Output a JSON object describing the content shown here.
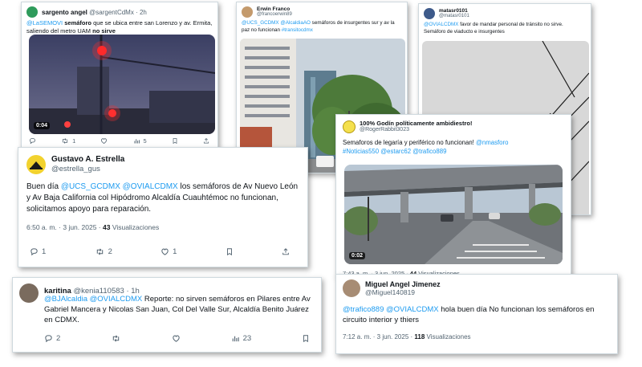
{
  "tweets": {
    "t1": {
      "name": "sargento angel",
      "handle": "@sargentCdMx",
      "sep": "·",
      "time": "2h",
      "mention": "@LaSEMOVI",
      "text_a": " semáforo",
      "text_b": " que se ubica entre san Lorenzo y av. Ermita, saliendo del metro UAM ",
      "text_c": "no sirve",
      "duration": "0:04",
      "retweets": "1",
      "likes": "5",
      "avatar_color": "#2e9b5b"
    },
    "t2": {
      "name": "Erwin Franco",
      "handle": "@francoerwin89",
      "mention_a": "@UCS_GCDMX",
      "mention_b": "@AlcaldiaAO",
      "text": " semáforos de insurgentes sur y av la paz no funcionan ",
      "hashtag": "#transitocdmx"
    },
    "t3": {
      "name": "matasr0101",
      "handle": "@matasr0101",
      "mention": "@OVIALCDMX",
      "text": " favor de mandar personal de tránsito no sirve. Semáforo de viaducto e insurgentes"
    },
    "t4": {
      "name": "Gustavo A. Estrella",
      "handle": "@estrella_gus",
      "text_a": "Buen día ",
      "mention_a": "@UCS_GCDMX",
      "mention_b": "@OVIALCDMX",
      "text_b": " los semáforos de Av Nuevo León y Av Baja California col Hipódromo Alcaldía Cuauhtémoc no funcionan, solicitamos apoyo para reparación.",
      "time": "6:50 a. m. · 3 jun. 2025 · ",
      "views_count": "43",
      "views_label": " Visualizaciones",
      "replies": "1",
      "retweets": "2",
      "likes": "1",
      "avatar_color": "#f2d22e"
    },
    "t5": {
      "name": "100% Godín políticamente ambidiestro!",
      "handle": "@RogerRabbit3023",
      "text": "Semaforos de legaría y periférico no funcionan! ",
      "mention_a": "@nmasforo",
      "hashtag": "#Noticias550",
      "mention_b": "@estarc62",
      "mention_c": "@trafico889",
      "duration": "0:02",
      "time": "7:43 a. m. · 3 jun. 2025 · ",
      "views_count": "44",
      "views_label": " Visualizaciones"
    },
    "t6": {
      "name": "karitina",
      "handle": "@kenia110583",
      "sep": "·",
      "time": "1h",
      "mention_a": "@BJAlcaldia",
      "mention_b": "@OVIALCDMX",
      "text": " Reporte: no sirven semáforos en Pilares entre Av Gabriel Mancera y Nicolas San Juan, Col Del Valle Sur, Alcaldía Benito Juárez en CDMX.",
      "replies": "2",
      "likes": "23"
    },
    "t7": {
      "name": "Miguel Angel Jimenez",
      "handle": "@Miguel140819",
      "mention_a": "@trafico889",
      "mention_b": "@OVIALCDMX",
      "text": " hola buen día   No funcionan los semáforos en circuito interior y thiers",
      "time": "7:12 a. m. · 3 jun. 2025 · ",
      "views_count": "118",
      "views_label": " Visualizaciones"
    }
  },
  "colors": {
    "link": "#1d9bf0",
    "secondary": "#536471",
    "text": "#0f1419"
  },
  "icons": [
    "reply-icon",
    "retweet-icon",
    "like-icon",
    "bookmark-icon",
    "share-icon"
  ]
}
